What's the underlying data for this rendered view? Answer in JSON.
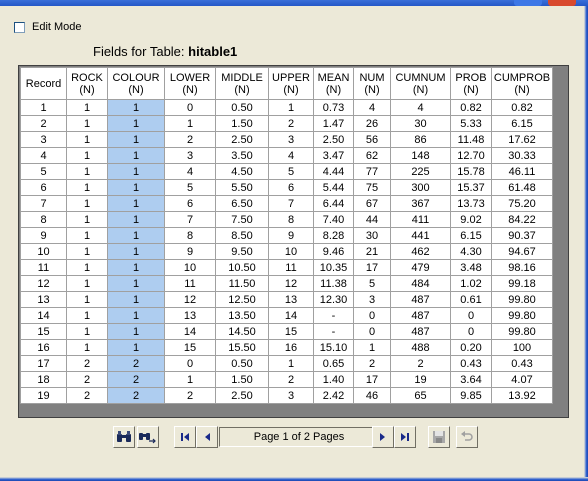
{
  "edit_mode": {
    "label": "Edit Mode",
    "checked": false
  },
  "fields_title": {
    "prefix": "Fields for Table:",
    "table_name": "hitable1"
  },
  "colors": {
    "colour_column_bg": "#aecdf0",
    "grid_footer": "#808080",
    "window_bg": "#ece9d8"
  },
  "columns": [
    {
      "name": "Record",
      "type": ""
    },
    {
      "name": "ROCK",
      "type": "(N)"
    },
    {
      "name": "COLOUR",
      "type": "(N)"
    },
    {
      "name": "LOWER",
      "type": "(N)"
    },
    {
      "name": "MIDDLE",
      "type": "(N)"
    },
    {
      "name": "UPPER",
      "type": "(N)"
    },
    {
      "name": "MEAN",
      "type": "(N)"
    },
    {
      "name": "NUM",
      "type": "(N)"
    },
    {
      "name": "CUMNUM",
      "type": "(N)"
    },
    {
      "name": "PROB",
      "type": "(N)"
    },
    {
      "name": "CUMPROB",
      "type": "(N)"
    }
  ],
  "rows": [
    [
      "1",
      "1",
      "1",
      "0",
      "0.50",
      "1",
      "0.73",
      "4",
      "4",
      "0.82",
      "0.82"
    ],
    [
      "2",
      "1",
      "1",
      "1",
      "1.50",
      "2",
      "1.47",
      "26",
      "30",
      "5.33",
      "6.15"
    ],
    [
      "3",
      "1",
      "1",
      "2",
      "2.50",
      "3",
      "2.50",
      "56",
      "86",
      "11.48",
      "17.62"
    ],
    [
      "4",
      "1",
      "1",
      "3",
      "3.50",
      "4",
      "3.47",
      "62",
      "148",
      "12.70",
      "30.33"
    ],
    [
      "5",
      "1",
      "1",
      "4",
      "4.50",
      "5",
      "4.44",
      "77",
      "225",
      "15.78",
      "46.11"
    ],
    [
      "6",
      "1",
      "1",
      "5",
      "5.50",
      "6",
      "5.44",
      "75",
      "300",
      "15.37",
      "61.48"
    ],
    [
      "7",
      "1",
      "1",
      "6",
      "6.50",
      "7",
      "6.44",
      "67",
      "367",
      "13.73",
      "75.20"
    ],
    [
      "8",
      "1",
      "1",
      "7",
      "7.50",
      "8",
      "7.40",
      "44",
      "411",
      "9.02",
      "84.22"
    ],
    [
      "9",
      "1",
      "1",
      "8",
      "8.50",
      "9",
      "8.28",
      "30",
      "441",
      "6.15",
      "90.37"
    ],
    [
      "10",
      "1",
      "1",
      "9",
      "9.50",
      "10",
      "9.46",
      "21",
      "462",
      "4.30",
      "94.67"
    ],
    [
      "11",
      "1",
      "1",
      "10",
      "10.50",
      "11",
      "10.35",
      "17",
      "479",
      "3.48",
      "98.16"
    ],
    [
      "12",
      "1",
      "1",
      "11",
      "11.50",
      "12",
      "11.38",
      "5",
      "484",
      "1.02",
      "99.18"
    ],
    [
      "13",
      "1",
      "1",
      "12",
      "12.50",
      "13",
      "12.30",
      "3",
      "487",
      "0.61",
      "99.80"
    ],
    [
      "14",
      "1",
      "1",
      "13",
      "13.50",
      "14",
      "-",
      "0",
      "487",
      "0",
      "99.80"
    ],
    [
      "15",
      "1",
      "1",
      "14",
      "14.50",
      "15",
      "-",
      "0",
      "487",
      "0",
      "99.80"
    ],
    [
      "16",
      "1",
      "1",
      "15",
      "15.50",
      "16",
      "15.10",
      "1",
      "488",
      "0.20",
      "100"
    ],
    [
      "17",
      "2",
      "2",
      "0",
      "0.50",
      "1",
      "0.65",
      "2",
      "2",
      "0.43",
      "0.43"
    ],
    [
      "18",
      "2",
      "2",
      "1",
      "1.50",
      "2",
      "1.40",
      "17",
      "19",
      "3.64",
      "4.07"
    ],
    [
      "19",
      "2",
      "2",
      "2",
      "2.50",
      "3",
      "2.42",
      "46",
      "65",
      "9.85",
      "13.92"
    ]
  ],
  "toolbar": {
    "find_icon": "binoculars-icon",
    "find_next_icon": "binoculars-arrow-icon",
    "first_icon": "first-page-icon",
    "prev_icon": "prev-page-icon",
    "page_label": "Page 1 of 2 Pages",
    "next_icon": "next-page-icon",
    "last_icon": "last-page-icon",
    "save_icon": "save-disk-icon",
    "undo_icon": "undo-icon"
  }
}
